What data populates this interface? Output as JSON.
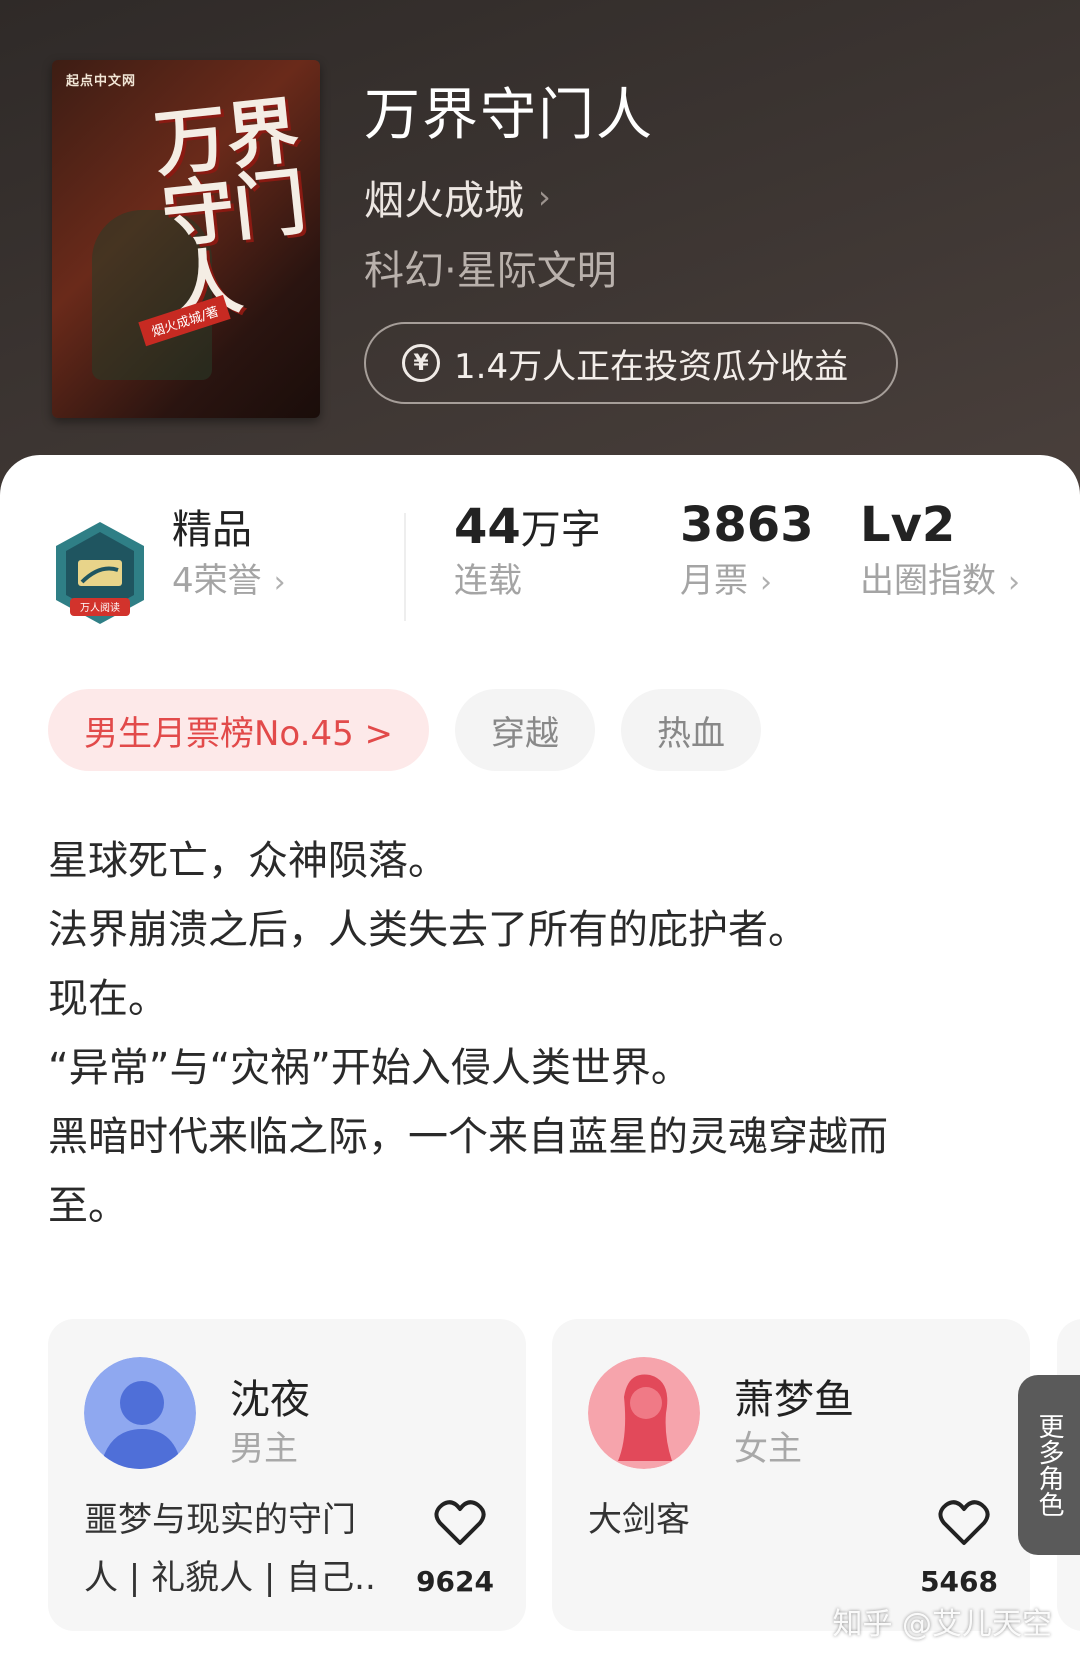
{
  "book": {
    "cover_brand": "起点中文网",
    "cover_title": "万界守门人",
    "cover_author": "烟火成城/著",
    "title": "万界守门人",
    "author": "烟火成城",
    "genre": "科幻·星际文明",
    "invest_text": "1.4万人正在投资瓜分收益",
    "invest_icon": "yen-circle-icon"
  },
  "stats": {
    "badge_label": "万人阅读",
    "quality": "精品",
    "honors": "4荣誉",
    "words_number": "44",
    "words_unit": "万字",
    "status": "连载",
    "monthly_votes": "3863",
    "monthly_votes_label": "月票",
    "level": "Lv2",
    "level_label": "出圈指数"
  },
  "tags": {
    "rank": "男生月票榜No.45 >",
    "tag1": "穿越",
    "tag2": "热血"
  },
  "description": [
    "星球死亡，众神陨落。",
    "法界崩溃之后，人类失去了所有的庇护者。",
    "现在。",
    "“异常”与“灾祸”开始入侵人类世界。",
    "黑暗时代来临之际，一个来自蓝星的灵魂穿越而",
    "至。"
  ],
  "characters": [
    {
      "name": "沈夜",
      "role": "男主",
      "desc_line1": "噩梦与现实的守门",
      "desc_line2": "人 | 礼貌人 | 自己...",
      "likes": "9624",
      "color": "#6f8ee6"
    },
    {
      "name": "萧梦鱼",
      "role": "女主",
      "desc_line1": "",
      "desc_line2": "大剑客",
      "likes": "5468",
      "color": "#ef6b77"
    }
  ],
  "more_characters": "更多角色",
  "watermark": "知乎 @艾儿天空",
  "colors": {
    "header_bg": "#3b3431",
    "rank_tag_bg": "#fde9e9",
    "rank_tag_text": "#e24a4a",
    "card_bg": "#f6f6f6"
  }
}
